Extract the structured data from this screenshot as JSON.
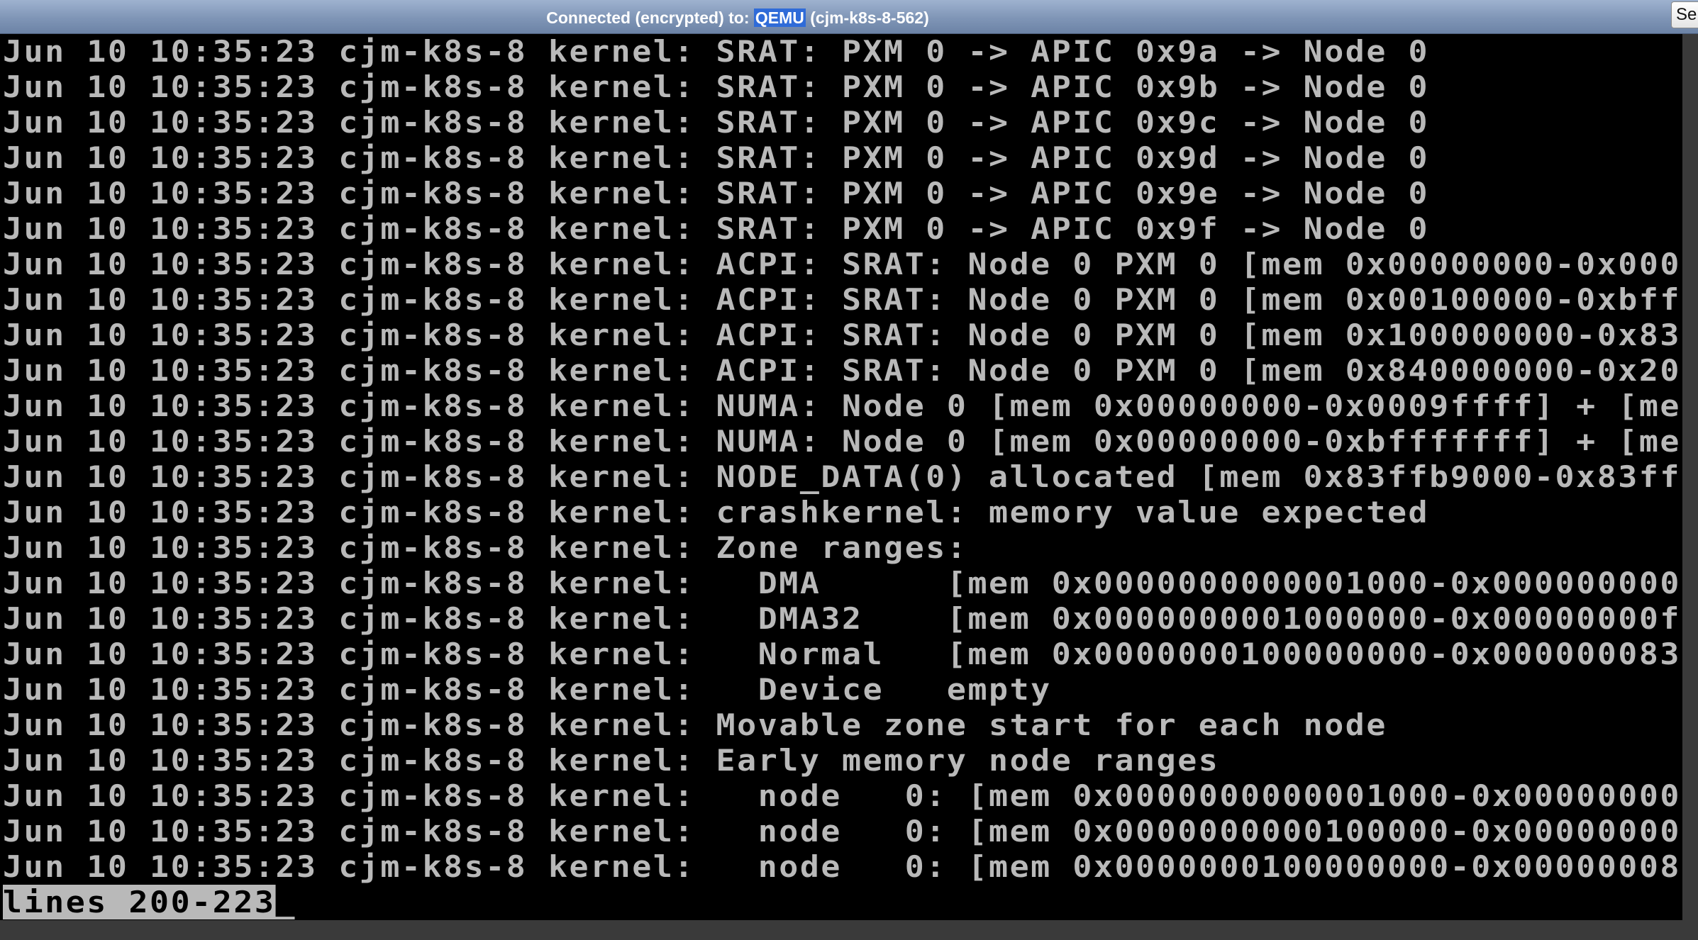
{
  "topbar": {
    "prefix": "Connected (encrypted) to: ",
    "host": "QEMU",
    "suffix": " (cjm-k8s-8-562)",
    "send_keys_label": "Se"
  },
  "console": {
    "lines": [
      "Jun 10 10:35:23 cjm-k8s-8 kernel: SRAT: PXM 0 -> APIC 0x9a -> Node 0",
      "Jun 10 10:35:23 cjm-k8s-8 kernel: SRAT: PXM 0 -> APIC 0x9b -> Node 0",
      "Jun 10 10:35:23 cjm-k8s-8 kernel: SRAT: PXM 0 -> APIC 0x9c -> Node 0",
      "Jun 10 10:35:23 cjm-k8s-8 kernel: SRAT: PXM 0 -> APIC 0x9d -> Node 0",
      "Jun 10 10:35:23 cjm-k8s-8 kernel: SRAT: PXM 0 -> APIC 0x9e -> Node 0",
      "Jun 10 10:35:23 cjm-k8s-8 kernel: SRAT: PXM 0 -> APIC 0x9f -> Node 0",
      "Jun 10 10:35:23 cjm-k8s-8 kernel: ACPI: SRAT: Node 0 PXM 0 [mem 0x00000000-0x000",
      "Jun 10 10:35:23 cjm-k8s-8 kernel: ACPI: SRAT: Node 0 PXM 0 [mem 0x00100000-0xbff",
      "Jun 10 10:35:23 cjm-k8s-8 kernel: ACPI: SRAT: Node 0 PXM 0 [mem 0x100000000-0x83",
      "Jun 10 10:35:23 cjm-k8s-8 kernel: ACPI: SRAT: Node 0 PXM 0 [mem 0x840000000-0x20",
      "Jun 10 10:35:23 cjm-k8s-8 kernel: NUMA: Node 0 [mem 0x00000000-0x0009ffff] + [me",
      "Jun 10 10:35:23 cjm-k8s-8 kernel: NUMA: Node 0 [mem 0x00000000-0xbfffffff] + [me",
      "Jun 10 10:35:23 cjm-k8s-8 kernel: NODE_DATA(0) allocated [mem 0x83ffb9000-0x83ff",
      "Jun 10 10:35:23 cjm-k8s-8 kernel: crashkernel: memory value expected",
      "Jun 10 10:35:23 cjm-k8s-8 kernel: Zone ranges:",
      "Jun 10 10:35:23 cjm-k8s-8 kernel:   DMA      [mem 0x0000000000001000-0x000000000",
      "Jun 10 10:35:23 cjm-k8s-8 kernel:   DMA32    [mem 0x0000000001000000-0x00000000f",
      "Jun 10 10:35:23 cjm-k8s-8 kernel:   Normal   [mem 0x0000000100000000-0x000000083",
      "Jun 10 10:35:23 cjm-k8s-8 kernel:   Device   empty",
      "Jun 10 10:35:23 cjm-k8s-8 kernel: Movable zone start for each node",
      "Jun 10 10:35:23 cjm-k8s-8 kernel: Early memory node ranges",
      "Jun 10 10:35:23 cjm-k8s-8 kernel:   node   0: [mem 0x0000000000001000-0x00000000",
      "Jun 10 10:35:23 cjm-k8s-8 kernel:   node   0: [mem 0x0000000000100000-0x00000000",
      "Jun 10 10:35:23 cjm-k8s-8 kernel:   node   0: [mem 0x0000000100000000-0x00000008"
    ],
    "pager_status": "lines 200-223",
    "cursor": "_"
  },
  "colors": {
    "console_bg": "#000000",
    "console_text": "#b9b9b9",
    "topbar_bg": "#8aa0c0",
    "host_highlight": "#2f6bd8"
  }
}
